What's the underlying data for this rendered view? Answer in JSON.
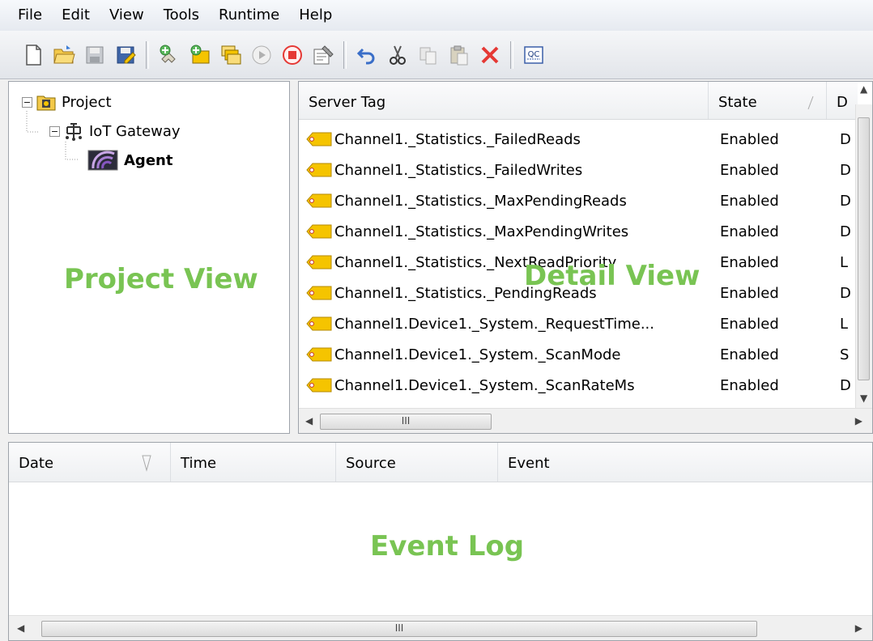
{
  "menu": [
    "File",
    "Edit",
    "View",
    "Tools",
    "Runtime",
    "Help"
  ],
  "toolbar": {
    "icons": [
      "new-file-icon",
      "open-folder-icon",
      "save-icon",
      "save-as-icon",
      "add-channel-icon",
      "add-device-icon",
      "add-group-icon",
      "start-icon",
      "stop-icon",
      "properties-icon",
      "undo-icon",
      "cut-icon",
      "copy-icon",
      "paste-icon",
      "delete-icon",
      "quick-client-icon"
    ],
    "qc_label": "QC"
  },
  "project_tree": {
    "root": "Project",
    "child": "IoT Gateway",
    "grandchild": "Agent",
    "expander_minus": "−"
  },
  "overlays": {
    "project": "Project View",
    "detail": "Detail View",
    "event": "Event Log"
  },
  "detail": {
    "columns": [
      "Server Tag",
      "State",
      "D"
    ],
    "rows": [
      {
        "tag": "Channel1._Statistics._FailedReads",
        "state": "Enabled",
        "desc": "D"
      },
      {
        "tag": "Channel1._Statistics._FailedWrites",
        "state": "Enabled",
        "desc": "D"
      },
      {
        "tag": "Channel1._Statistics._MaxPendingReads",
        "state": "Enabled",
        "desc": "D"
      },
      {
        "tag": "Channel1._Statistics._MaxPendingWrites",
        "state": "Enabled",
        "desc": "D"
      },
      {
        "tag": "Channel1._Statistics._NextReadPriority",
        "state": "Enabled",
        "desc": "L"
      },
      {
        "tag": "Channel1._Statistics._PendingReads",
        "state": "Enabled",
        "desc": "D"
      },
      {
        "tag": "Channel1.Device1._System._RequestTime...",
        "state": "Enabled",
        "desc": "L"
      },
      {
        "tag": "Channel1.Device1._System._ScanMode",
        "state": "Enabled",
        "desc": "S"
      },
      {
        "tag": "Channel1.Device1._System._ScanRateMs",
        "state": "Enabled",
        "desc": "D"
      }
    ],
    "scroll_thumb_label": "III"
  },
  "event_log": {
    "columns": [
      "Date",
      "Time",
      "Source",
      "Event"
    ],
    "scroll_thumb_label": "III"
  },
  "colors": {
    "overlay_green": "#79c453",
    "tag_icon": "#f5c400"
  }
}
